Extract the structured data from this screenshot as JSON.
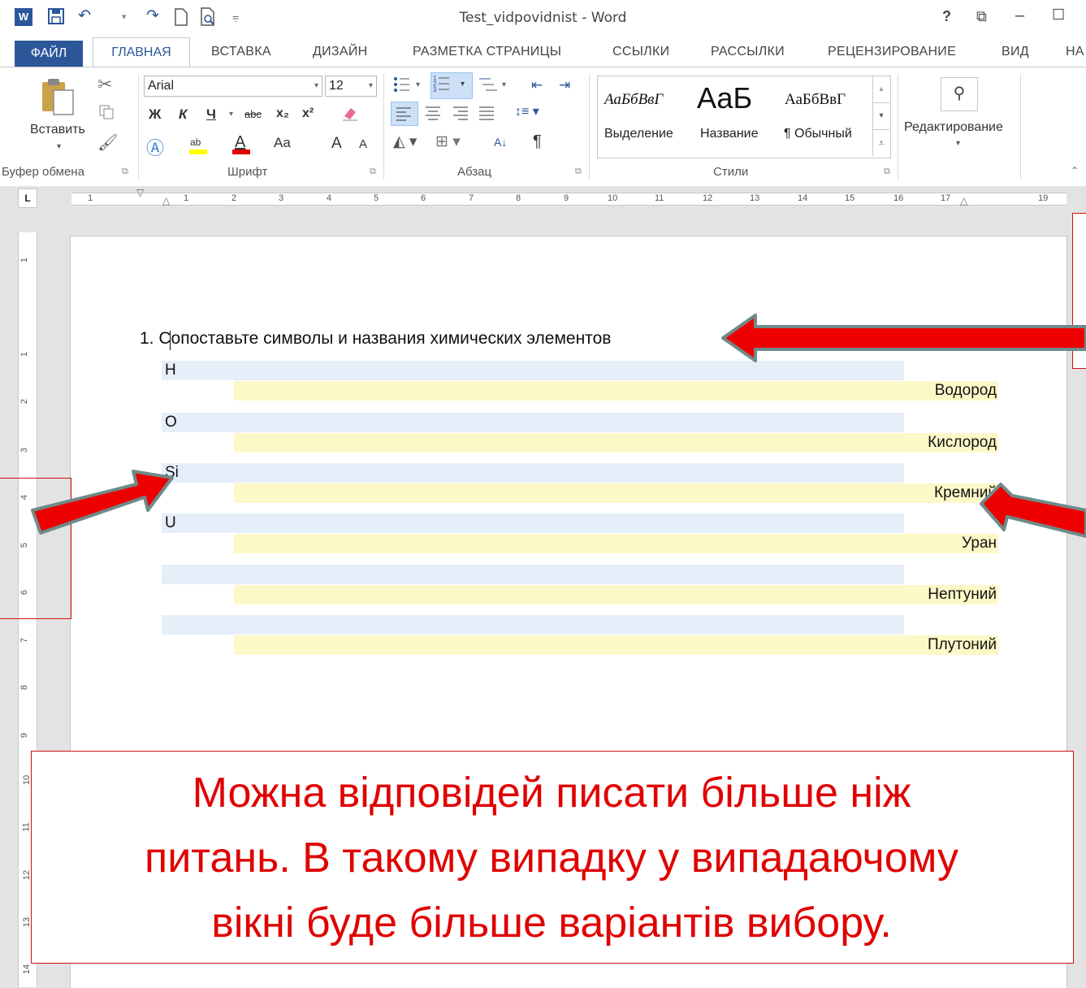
{
  "window": {
    "title": "Test_vidpovidnist - Word",
    "controls": [
      "?",
      "⧉",
      "–",
      "☐"
    ]
  },
  "tabs": [
    "ФАЙЛ",
    "ГЛАВНАЯ",
    "ВСТАВКА",
    "ДИЗАЙН",
    "РАЗМЕТКА СТРАНИЦЫ",
    "ССЫЛКИ",
    "РАССЫЛКИ",
    "РЕЦЕНЗИРОВАНИЕ",
    "ВИД",
    "НА"
  ],
  "ribbon": {
    "clipboard": {
      "paste_label": "Вставить",
      "group_label": "Буфер обмена"
    },
    "font": {
      "font_name": "Arial",
      "font_size": "12",
      "group_label": "Шрифт",
      "bold": "Ж",
      "italic": "К",
      "underline": "Ч",
      "strike": "abc",
      "sub": "x₂",
      "sup": "x²",
      "case": "Aa",
      "grow": "A",
      "shrink": "A"
    },
    "paragraph": {
      "group_label": "Абзац",
      "pilcrow": "¶",
      "sort": "А↓"
    },
    "styles": {
      "group_label": "Стили",
      "items": [
        {
          "preview": "АаБбВвГ",
          "name": "Выделение"
        },
        {
          "preview": "АаБ",
          "name": "Название"
        },
        {
          "preview": "АаБбВвГ",
          "name": "¶ Обычный"
        }
      ]
    },
    "editing": {
      "label": "Редактирование"
    }
  },
  "ruler": {
    "h_numbers": [
      "1",
      "1",
      "2",
      "3",
      "4",
      "5",
      "6",
      "7",
      "8",
      "9",
      "10",
      "11",
      "12",
      "13",
      "14",
      "15",
      "16",
      "17",
      "19"
    ],
    "v_numbers": [
      "1",
      "1",
      "2",
      "3",
      "4",
      "5",
      "6",
      "7",
      "8",
      "9",
      "10",
      "11",
      "12",
      "13",
      "14"
    ]
  },
  "document": {
    "question": "1.  Сопоставьте символы и названия химических элементов",
    "pairs": [
      {
        "symbol": "H",
        "answer": "Водород"
      },
      {
        "symbol": "O",
        "answer": "Кислород"
      },
      {
        "symbol": "Si",
        "answer": "Кремний"
      },
      {
        "symbol": "U",
        "answer": "Уран"
      },
      {
        "symbol": "",
        "answer": "Нептуний"
      },
      {
        "symbol": "",
        "answer": "Плутоний"
      }
    ]
  },
  "annotation": {
    "line1": "Можна відповідей писати більше ніж",
    "line2": "питань. В такому випадку у випадаючому",
    "line3": "вікні буде більше варіантів вибору.",
    "color": "#e00000"
  },
  "colors": {
    "accent": "#2b579a",
    "question_fill": "#e6eefa",
    "answer_fill": "#fdf8c8",
    "arrow": "#ee0000"
  }
}
